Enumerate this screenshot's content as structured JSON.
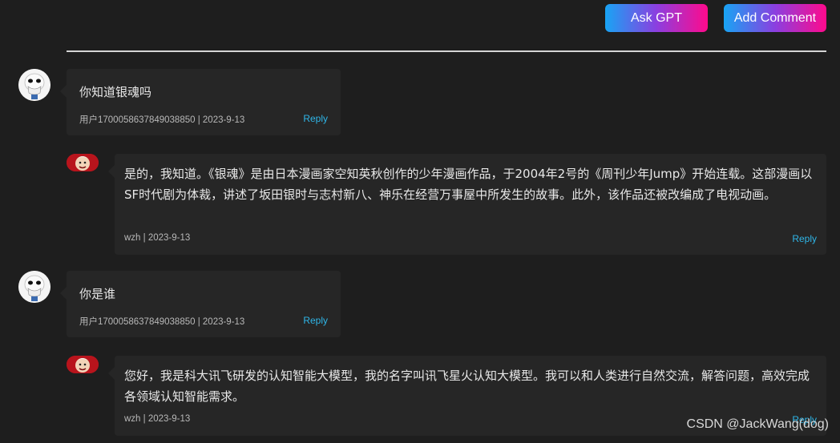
{
  "toolbar": {
    "ask_gpt_label": "Ask GPT",
    "add_comment_label": "Add Comment"
  },
  "comments": [
    {
      "role": "user",
      "text": "你知道银魂吗",
      "meta": "用户1700058637849038850 | 2023-9-13",
      "reply_label": "Reply"
    },
    {
      "role": "bot",
      "text": "是的，我知道。《银魂》是由日本漫画家空知英秋创作的少年漫画作品，于2004年2号的《周刊少年Jump》开始连载。这部漫画以SF时代剧为体裁，讲述了坂田银时与志村新八、神乐在经营万事屋中所发生的故事。此外，该作品还被改编成了电视动画。",
      "meta": "wzh | 2023-9-13",
      "reply_label": "Reply"
    },
    {
      "role": "user",
      "text": "你是谁",
      "meta": "用户1700058637849038850 | 2023-9-13",
      "reply_label": "Reply"
    },
    {
      "role": "bot",
      "text": "您好，我是科大讯飞研发的认知智能大模型，我的名字叫讯飞星火认知大模型。我可以和人类进行自然交流，解答问题，高效完成各领域认知智能需求。",
      "meta": "wzh | 2023-9-13",
      "reply_label": "Reply"
    }
  ],
  "watermark": "CSDN @JackWang(dog)",
  "colors": {
    "background": "#1e1e1e",
    "bubble": "#262626",
    "link": "#2fb6e8",
    "gradient_start": "#18a4f4",
    "gradient_end": "#ff0a8c"
  }
}
